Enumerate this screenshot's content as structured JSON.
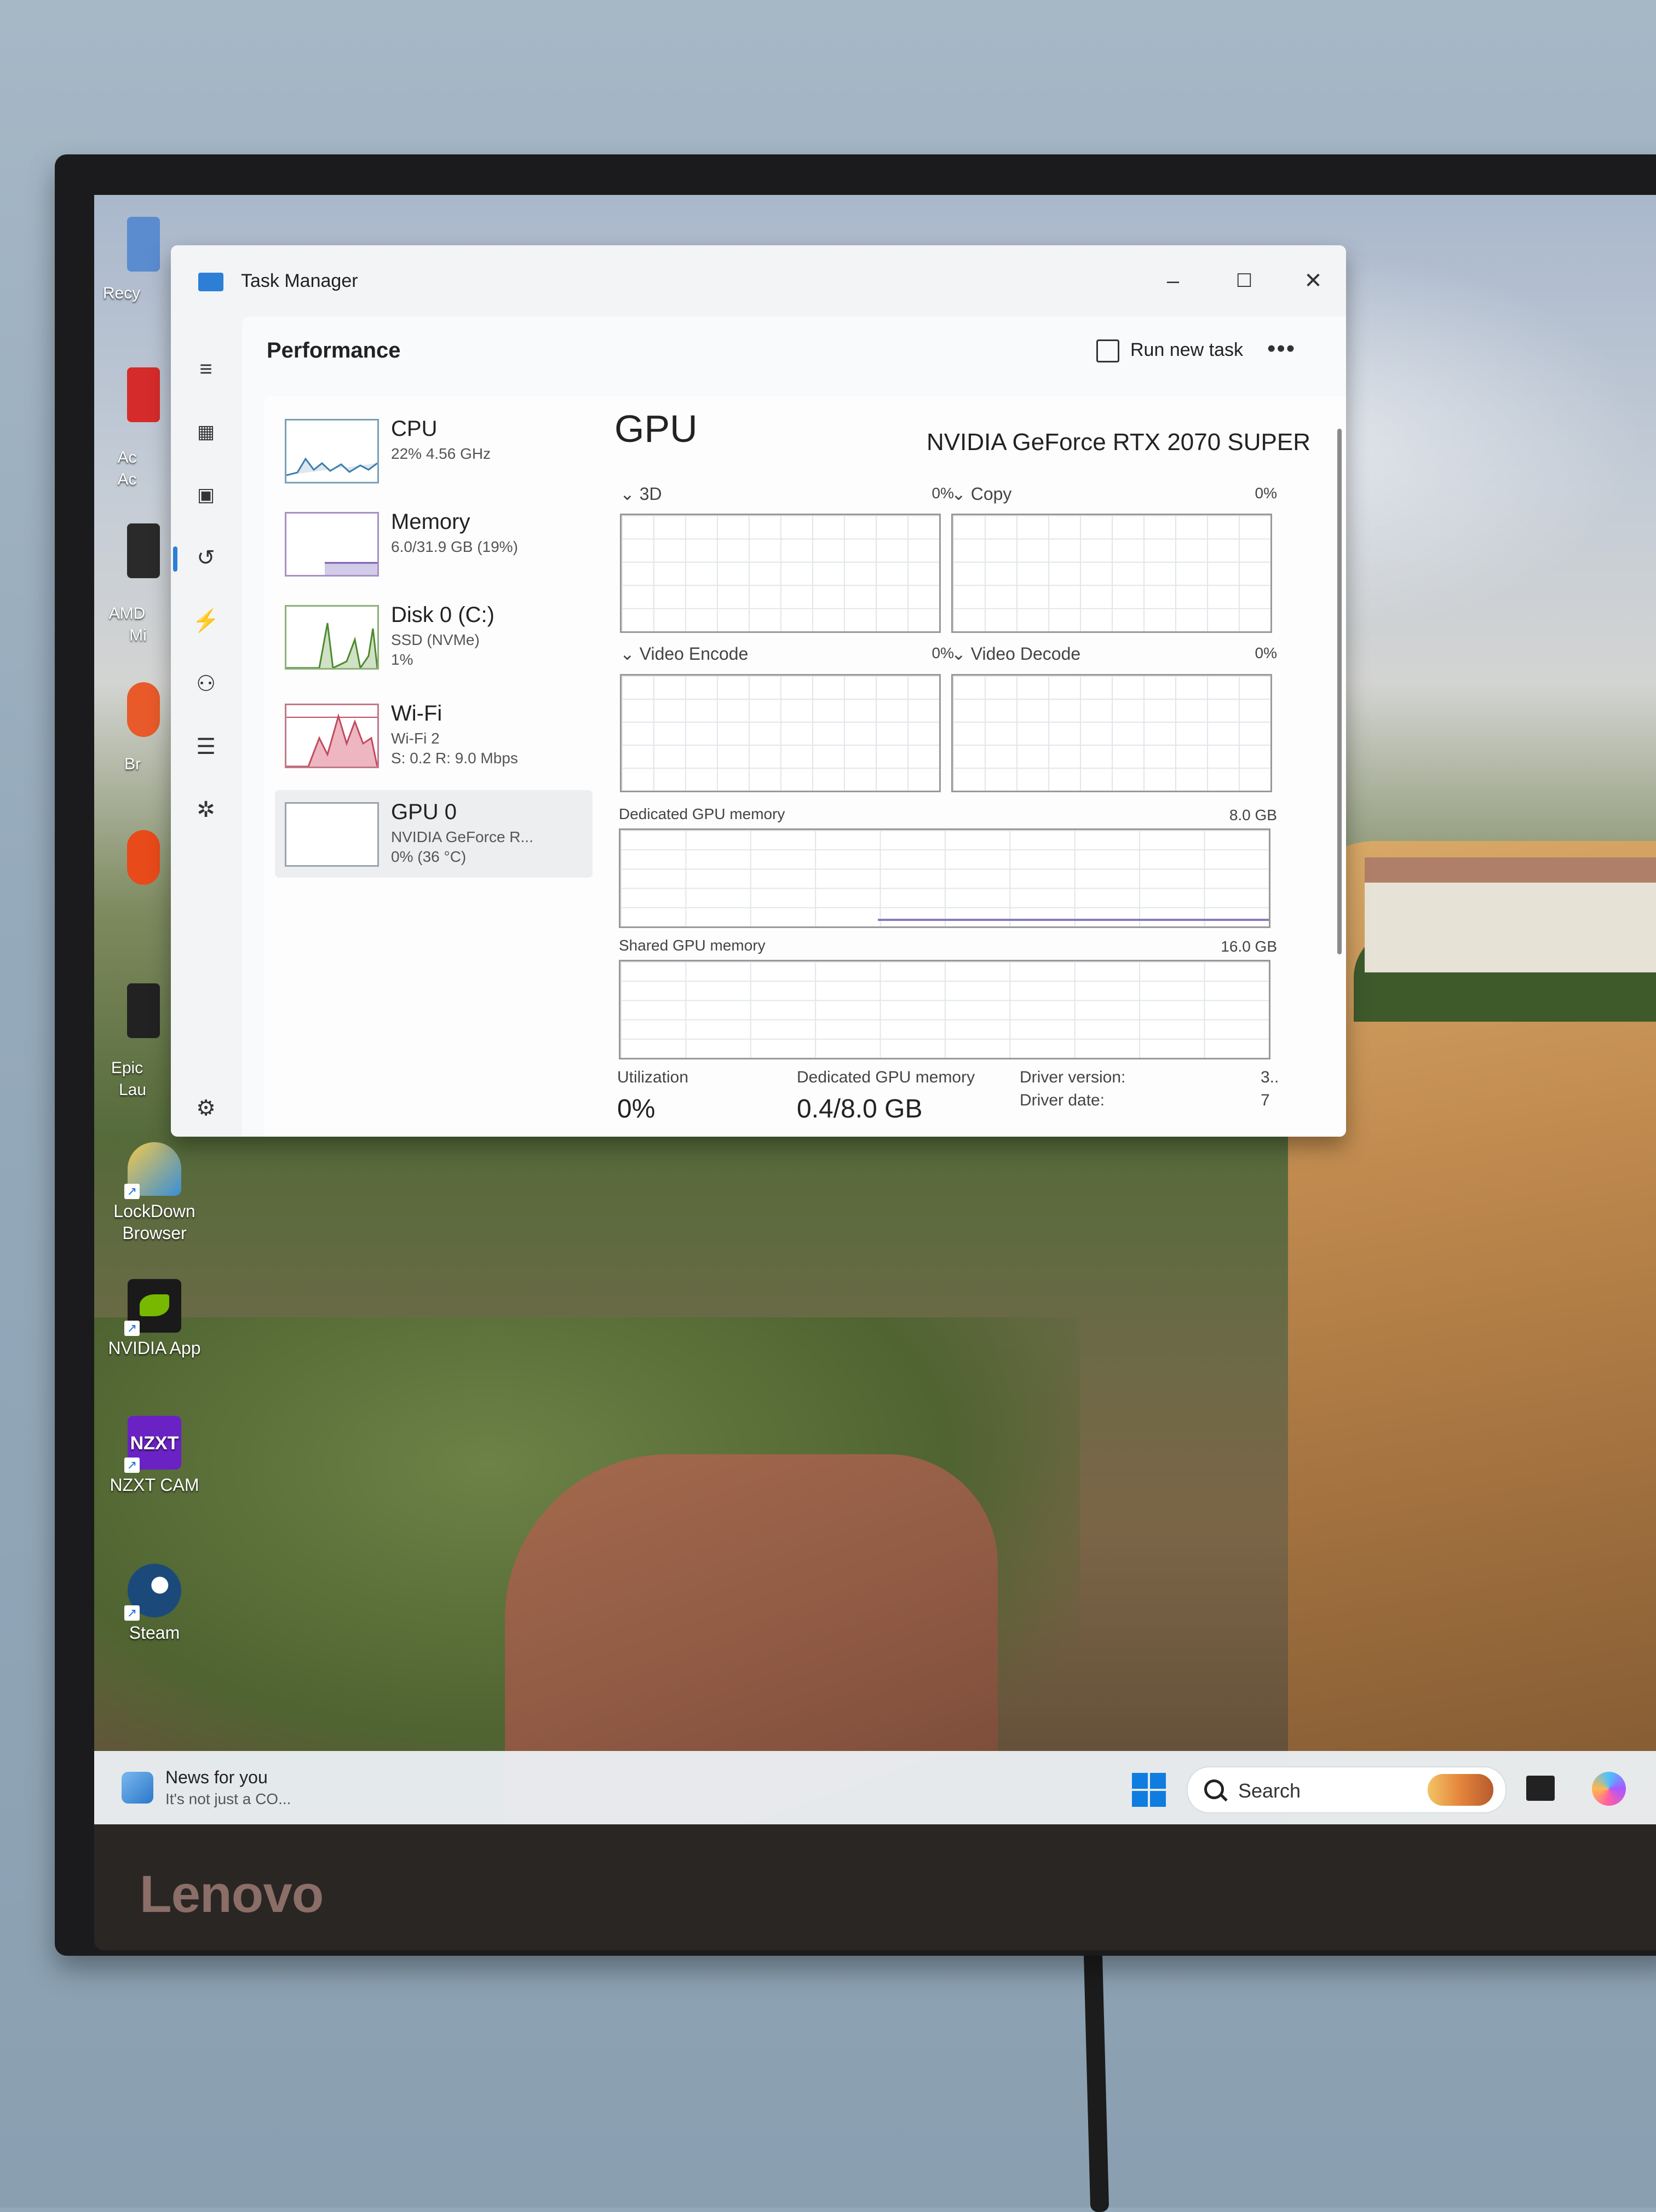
{
  "monitor": {
    "brand": "Lenovo"
  },
  "desktop": {
    "icons": [
      {
        "label": "LockDown Browser"
      },
      {
        "label": "NVIDIA App"
      },
      {
        "label": "NZXT CAM"
      },
      {
        "label": "Steam"
      }
    ],
    "partial_labels": [
      "Recy",
      "Ac",
      "Ac",
      "AMD",
      "Mi",
      "Br",
      "Epic",
      "Lau"
    ],
    "nzxt_logo_text": "NZXT"
  },
  "taskbar": {
    "news_title": "News for you",
    "news_subtitle": "It's not just a CO...",
    "search_placeholder": "Search"
  },
  "task_manager": {
    "title": "Task Manager",
    "window_controls": {
      "minimize": "–",
      "maximize": "☐",
      "close": "✕"
    },
    "section": "Performance",
    "run_new_task": "Run new task",
    "more": "•••",
    "devices": [
      {
        "name": "CPU",
        "line1": "22% 4.56 GHz",
        "line2": ""
      },
      {
        "name": "Memory",
        "line1": "6.0/31.9 GB (19%)",
        "line2": ""
      },
      {
        "name": "Disk 0 (C:)",
        "line1": "SSD (NVMe)",
        "line2": "1%"
      },
      {
        "name": "Wi-Fi",
        "line1": "Wi-Fi 2",
        "line2": "S: 0.2 R: 9.0 Mbps"
      },
      {
        "name": "GPU 0",
        "line1": "NVIDIA GeForce R...",
        "line2": "0% (36 °C)"
      }
    ],
    "gpu": {
      "heading": "GPU",
      "model": "NVIDIA GeForce RTX 2070 SUPER",
      "engines": [
        {
          "label": "3D",
          "pct": "0%"
        },
        {
          "label": "Copy",
          "pct": "0%"
        },
        {
          "label": "Video Encode",
          "pct": "0%"
        },
        {
          "label": "Video Decode",
          "pct": "0%"
        }
      ],
      "dedicated_label": "Dedicated GPU memory",
      "dedicated_max": "8.0 GB",
      "shared_label": "Shared GPU memory",
      "shared_max": "16.0 GB",
      "stats": {
        "utilization_label": "Utilization",
        "utilization_value": "0%",
        "dedicated_label": "Dedicated GPU memory",
        "dedicated_value": "0.4/8.0 GB",
        "driver_version_label": "Driver version:",
        "driver_version_value": "3..",
        "driver_date_label": "Driver date:",
        "driver_date_value": "7"
      }
    }
  }
}
